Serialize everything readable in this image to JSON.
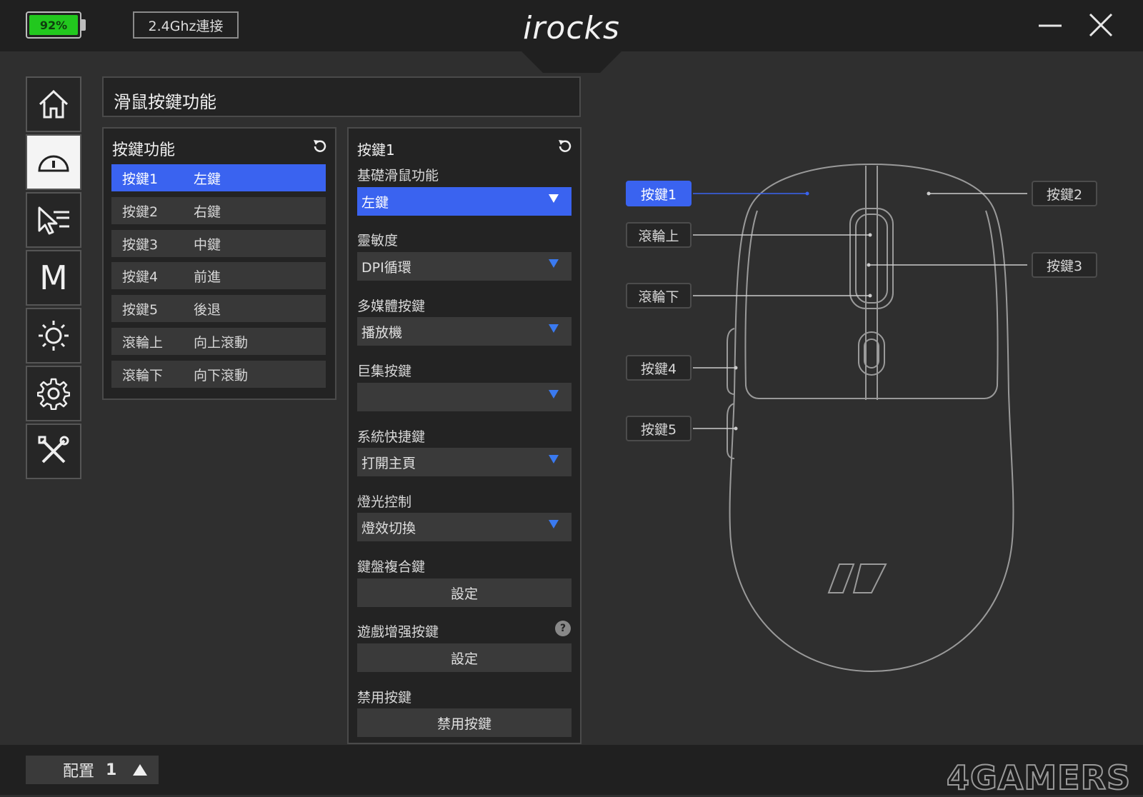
{
  "titlebar": {
    "battery": "92%",
    "connection": "2.4Ghz連接",
    "logo": "irocks"
  },
  "sidebar": {
    "items": [
      {
        "name": "home-icon"
      },
      {
        "name": "mouse-icon",
        "active": true
      },
      {
        "name": "pointer-speed-icon"
      },
      {
        "name": "macro-icon",
        "label": "M"
      },
      {
        "name": "lighting-icon"
      },
      {
        "name": "gear-icon"
      },
      {
        "name": "tools-icon"
      }
    ]
  },
  "page": {
    "title": "滑鼠按鍵功能"
  },
  "key_panel": {
    "title": "按鍵功能",
    "rows": [
      {
        "key": "按鍵1",
        "func": "左鍵",
        "selected": true
      },
      {
        "key": "按鍵2",
        "func": "右鍵"
      },
      {
        "key": "按鍵3",
        "func": "中鍵"
      },
      {
        "key": "按鍵4",
        "func": "前進"
      },
      {
        "key": "按鍵5",
        "func": "後退"
      },
      {
        "key": "滾輪上",
        "func": "向上滾動"
      },
      {
        "key": "滾輪下",
        "func": "向下滾動"
      }
    ]
  },
  "settings_panel": {
    "title": "按鍵1",
    "basic": {
      "label": "基礎滑鼠功能",
      "value": "左鍵"
    },
    "sensitivity": {
      "label": "靈敏度",
      "value": "DPI循環"
    },
    "media": {
      "label": "多媒體按鍵",
      "value": "播放機"
    },
    "macro": {
      "label": "巨集按鍵",
      "value": ""
    },
    "shortcut": {
      "label": "系統快捷鍵",
      "value": "打開主頁"
    },
    "lighting": {
      "label": "燈光控制",
      "value": "燈效切換"
    },
    "combo": {
      "label": "鍵盤複合鍵",
      "button": "設定"
    },
    "game": {
      "label": "遊戲增强按鍵",
      "button": "設定",
      "help": "?"
    },
    "disable": {
      "label": "禁用按鍵",
      "button": "禁用按鍵"
    }
  },
  "mouse_map": {
    "left_tags": [
      "按鍵1",
      "滾輪上",
      "滾輪下",
      "按鍵4",
      "按鍵5"
    ],
    "right_tags": [
      "按鍵2",
      "按鍵3"
    ]
  },
  "footer": {
    "profile_label": "配置",
    "profile_number": "1",
    "watermark": "4GAMERS"
  },
  "colors": {
    "accent": "#3a63f0",
    "battery": "#22c81e"
  }
}
